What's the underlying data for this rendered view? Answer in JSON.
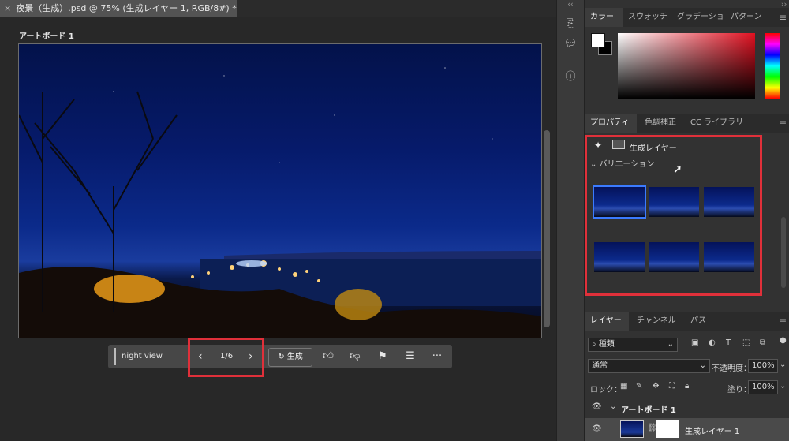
{
  "document": {
    "tab_title": "夜景（生成）.psd @ 75% (生成レイヤー 1, RGB/8#) *",
    "close_glyph": "×",
    "artboard_label": "アートボード 1"
  },
  "context_bar": {
    "prompt": "night view",
    "prev": "‹",
    "next": "›",
    "counter": "1/6",
    "generate_label": "生成",
    "more": "···"
  },
  "color_panel": {
    "tabs": [
      "カラー",
      "スウォッチ",
      "グラデーショ",
      "パターン"
    ],
    "active_tab": 0
  },
  "properties_panel": {
    "tabs": [
      "プロパティ",
      "色調補正",
      "CC ライブラリ"
    ],
    "active_tab": 0,
    "layer_type": "生成レイヤー",
    "variations_label": "バリエーション",
    "variations_count": 6,
    "selected_variation": 1
  },
  "layers_panel": {
    "tabs": [
      "レイヤー",
      "チャンネル",
      "パス"
    ],
    "active_tab": 0,
    "filter_label": "種類",
    "blend_mode": "通常",
    "opacity_label": "不透明度：",
    "opacity_value": "100%",
    "lock_label": "ロック：",
    "fill_label": "塗り：",
    "fill_value": "100%",
    "layers": [
      {
        "name": "アートボード 1",
        "visible": true,
        "type": "group"
      },
      {
        "name": "生成レイヤー 1",
        "visible": true,
        "type": "generative"
      }
    ]
  },
  "colors": {
    "highlight": "#e0303a",
    "selection": "#3b7bff",
    "panel_bg": "#323232"
  }
}
